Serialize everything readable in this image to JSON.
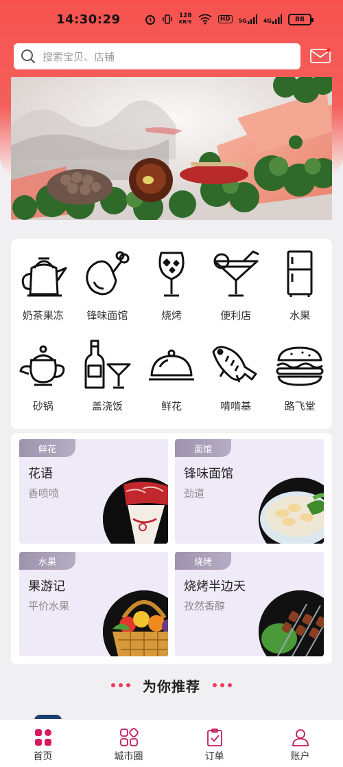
{
  "status_bar": {
    "time": "14:30:29",
    "net_speed_top": "128",
    "net_speed_unit": "KB/S",
    "hd_label": "HD",
    "signal1_label": "5G",
    "signal2_label": "4G",
    "battery": "88"
  },
  "search": {
    "placeholder": "搜索宝贝、店铺"
  },
  "categories": [
    {
      "label": "奶茶果冻",
      "icon": "kettle-icon"
    },
    {
      "label": "锋味面馆",
      "icon": "drumstick-icon"
    },
    {
      "label": "烧烤",
      "icon": "wine-glass-icon"
    },
    {
      "label": "便利店",
      "icon": "cocktail-icon"
    },
    {
      "label": "水果",
      "icon": "fridge-icon"
    },
    {
      "label": "砂锅",
      "icon": "teapot-icon"
    },
    {
      "label": "盖浇饭",
      "icon": "bottle-glass-icon"
    },
    {
      "label": "鲜花",
      "icon": "cloche-icon"
    },
    {
      "label": "啃啃基",
      "icon": "fish-icon"
    },
    {
      "label": "路飞堂",
      "icon": "burger-icon"
    }
  ],
  "promos": [
    {
      "tag": "鲜花",
      "title": "花语",
      "subtitle": "香喷喷"
    },
    {
      "tag": "面馆",
      "title": "锋味面馆",
      "subtitle": "劲道"
    },
    {
      "tag": "水果",
      "title": "果游记",
      "subtitle": "平价水果"
    },
    {
      "tag": "烧烤",
      "title": "烧烤半边天",
      "subtitle": "孜然香醇"
    }
  ],
  "recommend": {
    "title": "为你推荐"
  },
  "nav": [
    {
      "label": "首页",
      "icon": "home-grid-icon",
      "active": true
    },
    {
      "label": "城市圈",
      "icon": "city-circle-icon",
      "active": false
    },
    {
      "label": "订单",
      "icon": "order-clipboard-icon",
      "active": false
    },
    {
      "label": "账户",
      "icon": "account-person-icon",
      "active": false
    }
  ],
  "colors": {
    "brand_red": "#f7524f",
    "accent_pink": "#ef3b58",
    "promo_bg": "#efeaf8",
    "tag_purple": "#9d93ad"
  }
}
